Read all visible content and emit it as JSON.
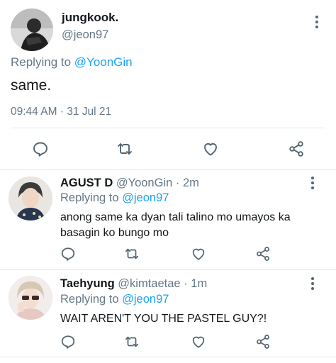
{
  "main_tweet": {
    "display_name": "jungkook.",
    "handle": "@jeon97",
    "replying_prefix": "Replying to ",
    "replying_to": "@YoonGin",
    "text": "same.",
    "timestamp": "09:44 AM · 31 Jul 21"
  },
  "replies": [
    {
      "display_name": "AGUST D",
      "handle": "@YoonGin",
      "time": "· 2m",
      "replying_prefix": "Replying to ",
      "replying_to": "@jeon97",
      "text": "anong same ka dyan tali talino mo umayos ka basagin ko bungo mo"
    },
    {
      "display_name": "Taehyung",
      "handle": "@kimtaetae",
      "time": "· 1m",
      "replying_prefix": "Replying to ",
      "replying_to": "@jeon97",
      "text": "WAIT AREN'T YOU THE PASTEL GUY?!"
    }
  ],
  "icons": [
    "more-vertical-icon",
    "reply-icon",
    "retweet-icon",
    "like-icon",
    "share-icon"
  ],
  "colors": {
    "link": "#1da1f2",
    "muted": "#657786",
    "icon": "#536471",
    "divider": "#e1e8ed"
  }
}
